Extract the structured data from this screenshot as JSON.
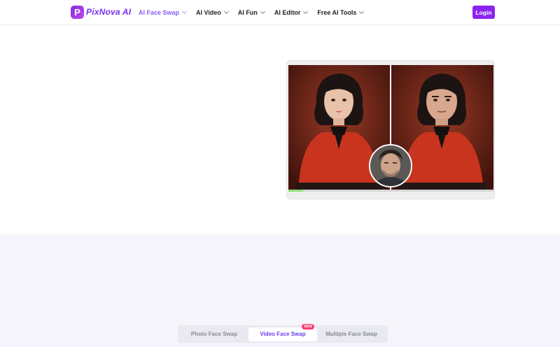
{
  "brand": {
    "logo_letter": "P",
    "logo_text": "PixNova AI"
  },
  "nav": {
    "items": [
      {
        "label": "AI Face Swap",
        "active": true
      },
      {
        "label": "AI Video"
      },
      {
        "label": "AI Fun"
      },
      {
        "label": "AI Editor"
      },
      {
        "label": "Free AI Tools"
      }
    ]
  },
  "header": {
    "login_label": "Login"
  },
  "hero": {
    "progress": 0.07
  },
  "tabs": [
    {
      "label": "Photo Face Swap"
    },
    {
      "label": "Video Face Swap",
      "badge": "NEW",
      "active": true
    },
    {
      "label": "Multiple Face Swap"
    }
  ],
  "colors": {
    "accent": "#8b23f0",
    "nav_active": "#8a5cf5",
    "tab_active_text": "#6b3ff0",
    "badge": "#ff3b6b"
  }
}
